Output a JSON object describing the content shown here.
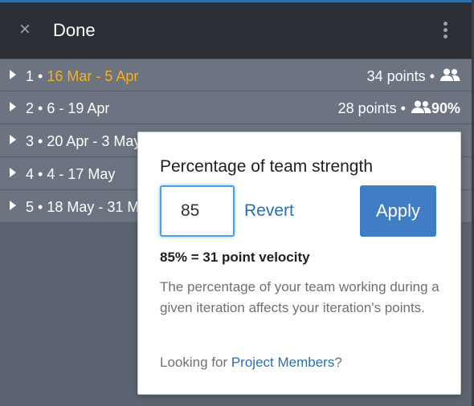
{
  "header": {
    "title": "Done",
    "close_icon": "×"
  },
  "iterations": [
    {
      "number": "1",
      "dates": "16 Mar - 5 Apr",
      "highlight": true,
      "points": "34 points",
      "strength": ""
    },
    {
      "number": "2",
      "dates": "6 - 19 Apr",
      "highlight": false,
      "points": "28 points",
      "strength": "90%"
    },
    {
      "number": "3",
      "dates": "20 Apr - 3 May",
      "highlight": false,
      "points": "",
      "strength": ""
    },
    {
      "number": "4",
      "dates": "4 - 17 May",
      "highlight": false,
      "points": "",
      "strength": ""
    },
    {
      "number": "5",
      "dates": "18 May - 31 M",
      "highlight": false,
      "points": "",
      "strength": ""
    }
  ],
  "popover": {
    "title": "Percentage of team strength",
    "input_value": "85",
    "revert_label": "Revert",
    "apply_label": "Apply",
    "velocity_text": "85% = 31 point velocity",
    "description": "The percentage of your team working during a given iteration affects your iteration's points.",
    "members_prefix": "Looking for ",
    "members_link": "Project Members",
    "members_suffix": "?"
  },
  "colors": {
    "accent": "#3f7ec7",
    "highlight_date": "#f5b021",
    "header_bg": "#2c3036",
    "row_bg": "#6b7480"
  },
  "icons": {
    "people": "people-icon",
    "kebab": "more-vertical-icon",
    "caret": "caret-right-icon"
  }
}
